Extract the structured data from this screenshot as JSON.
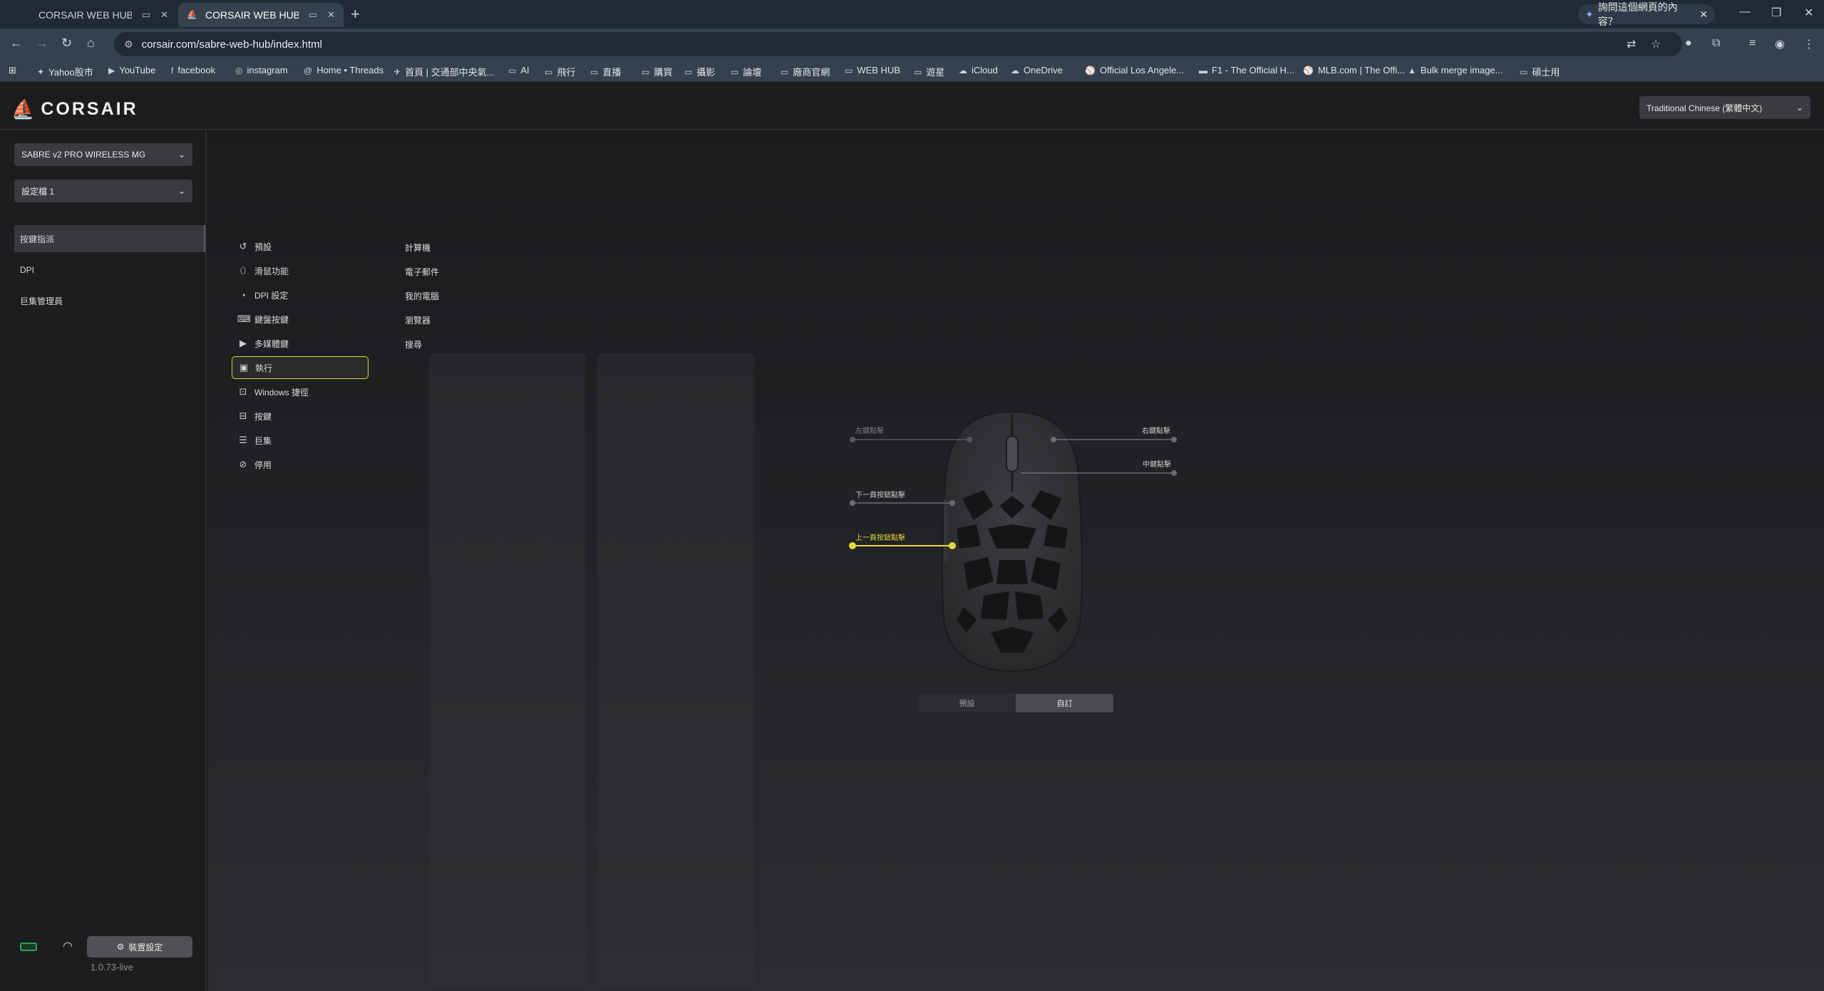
{
  "browser": {
    "tabs": [
      {
        "title": "CORSAIR WEB HUB"
      },
      {
        "title": "CORSAIR WEB HUB"
      }
    ],
    "ai_prompt": "詢問這個網頁的內容？",
    "url": "corsair.com/sabre-web-hub/index.html",
    "bookmarks": [
      "Yahoo股市",
      "YouTube",
      "facebook",
      "instagram",
      "Home • Threads",
      "首頁 | 交通部中央氣...",
      "AI",
      "飛行",
      "直播",
      "購買",
      "攝影",
      "論壇",
      "廠商官網",
      "WEB HUB",
      "遊星",
      "iCloud",
      "OneDrive",
      "Official Los Angele...",
      "F1 - The Official H...",
      "MLB.com | The Offi...",
      "Bulk merge image...",
      "碩士用"
    ]
  },
  "app": {
    "logo": "CORSAIR",
    "language": "Traditional Chinese (繁體中文)",
    "device": "SABRE v2 PRO WIRELESS MG",
    "profile": "設定檔 1",
    "nav": [
      "按鍵指派",
      "DPI",
      "巨集管理員"
    ],
    "device_settings": "裝置設定",
    "version": "1.0.73-live"
  },
  "actions": [
    {
      "label": "預設",
      "icon": "reset-icon"
    },
    {
      "label": "滑鼠功能",
      "icon": "mouse-icon"
    },
    {
      "label": "DPI 設定",
      "icon": "dpi-icon"
    },
    {
      "label": "鍵盤按鍵",
      "icon": "keyboard-icon"
    },
    {
      "label": "多媒體鍵",
      "icon": "media-icon"
    },
    {
      "label": "執行",
      "icon": "launch-icon"
    },
    {
      "label": "Windows 捷徑",
      "icon": "windows-shortcut-icon"
    },
    {
      "label": "按鍵",
      "icon": "key-icon"
    },
    {
      "label": "巨集",
      "icon": "macro-icon"
    },
    {
      "label": "停用",
      "icon": "disable-icon"
    }
  ],
  "selected_action": "執行",
  "sub_actions": [
    "計算機",
    "電子郵件",
    "我的電腦",
    "瀏覽器",
    "搜尋"
  ],
  "mouse_buttons": {
    "left": "左鍵點擊",
    "right": "右鍵點擊",
    "middle": "中鍵點擊",
    "back": "下一頁按鈕點擊",
    "forward": "上一頁按鈕點擊"
  },
  "highlight_color": "#e6d738",
  "modes": {
    "preset": "預設",
    "custom": "自訂"
  }
}
